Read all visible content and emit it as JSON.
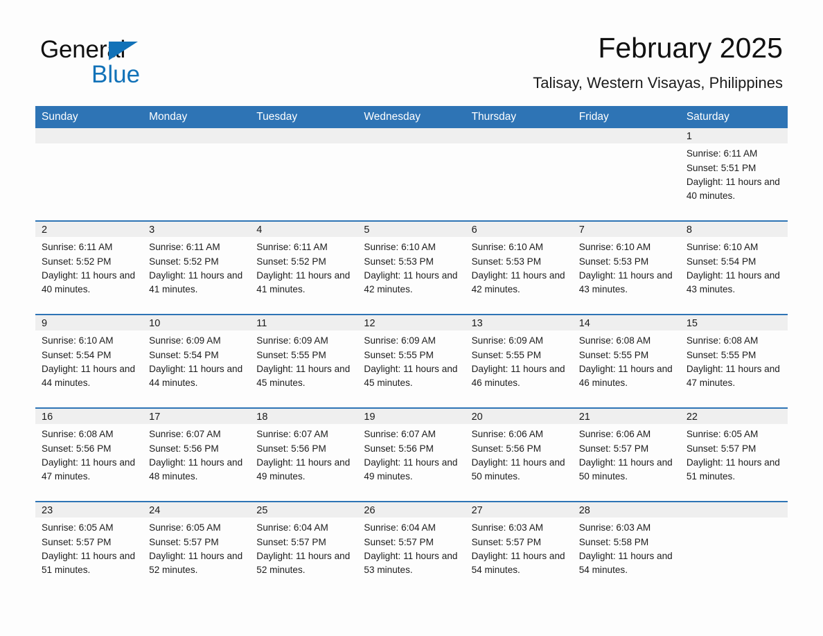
{
  "brand": {
    "name_part1": "General",
    "name_part2": "Blue",
    "accent_color": "#1272b8",
    "header_color": "#2e74b5"
  },
  "header": {
    "title": "February 2025",
    "location": "Talisay, Western Visayas, Philippines"
  },
  "calendar": {
    "weekday_headers": [
      "Sunday",
      "Monday",
      "Tuesday",
      "Wednesday",
      "Thursday",
      "Friday",
      "Saturday"
    ],
    "labels": {
      "sunrise": "Sunrise:",
      "sunset": "Sunset:",
      "daylight": "Daylight:"
    },
    "weeks": [
      [
        {
          "day": ""
        },
        {
          "day": ""
        },
        {
          "day": ""
        },
        {
          "day": ""
        },
        {
          "day": ""
        },
        {
          "day": ""
        },
        {
          "day": "1",
          "sunrise": "Sunrise: 6:11 AM",
          "sunset": "Sunset: 5:51 PM",
          "daylight": "Daylight: 11 hours and 40 minutes."
        }
      ],
      [
        {
          "day": "2",
          "sunrise": "Sunrise: 6:11 AM",
          "sunset": "Sunset: 5:52 PM",
          "daylight": "Daylight: 11 hours and 40 minutes."
        },
        {
          "day": "3",
          "sunrise": "Sunrise: 6:11 AM",
          "sunset": "Sunset: 5:52 PM",
          "daylight": "Daylight: 11 hours and 41 minutes."
        },
        {
          "day": "4",
          "sunrise": "Sunrise: 6:11 AM",
          "sunset": "Sunset: 5:52 PM",
          "daylight": "Daylight: 11 hours and 41 minutes."
        },
        {
          "day": "5",
          "sunrise": "Sunrise: 6:10 AM",
          "sunset": "Sunset: 5:53 PM",
          "daylight": "Daylight: 11 hours and 42 minutes."
        },
        {
          "day": "6",
          "sunrise": "Sunrise: 6:10 AM",
          "sunset": "Sunset: 5:53 PM",
          "daylight": "Daylight: 11 hours and 42 minutes."
        },
        {
          "day": "7",
          "sunrise": "Sunrise: 6:10 AM",
          "sunset": "Sunset: 5:53 PM",
          "daylight": "Daylight: 11 hours and 43 minutes."
        },
        {
          "day": "8",
          "sunrise": "Sunrise: 6:10 AM",
          "sunset": "Sunset: 5:54 PM",
          "daylight": "Daylight: 11 hours and 43 minutes."
        }
      ],
      [
        {
          "day": "9",
          "sunrise": "Sunrise: 6:10 AM",
          "sunset": "Sunset: 5:54 PM",
          "daylight": "Daylight: 11 hours and 44 minutes."
        },
        {
          "day": "10",
          "sunrise": "Sunrise: 6:09 AM",
          "sunset": "Sunset: 5:54 PM",
          "daylight": "Daylight: 11 hours and 44 minutes."
        },
        {
          "day": "11",
          "sunrise": "Sunrise: 6:09 AM",
          "sunset": "Sunset: 5:55 PM",
          "daylight": "Daylight: 11 hours and 45 minutes."
        },
        {
          "day": "12",
          "sunrise": "Sunrise: 6:09 AM",
          "sunset": "Sunset: 5:55 PM",
          "daylight": "Daylight: 11 hours and 45 minutes."
        },
        {
          "day": "13",
          "sunrise": "Sunrise: 6:09 AM",
          "sunset": "Sunset: 5:55 PM",
          "daylight": "Daylight: 11 hours and 46 minutes."
        },
        {
          "day": "14",
          "sunrise": "Sunrise: 6:08 AM",
          "sunset": "Sunset: 5:55 PM",
          "daylight": "Daylight: 11 hours and 46 minutes."
        },
        {
          "day": "15",
          "sunrise": "Sunrise: 6:08 AM",
          "sunset": "Sunset: 5:55 PM",
          "daylight": "Daylight: 11 hours and 47 minutes."
        }
      ],
      [
        {
          "day": "16",
          "sunrise": "Sunrise: 6:08 AM",
          "sunset": "Sunset: 5:56 PM",
          "daylight": "Daylight: 11 hours and 47 minutes."
        },
        {
          "day": "17",
          "sunrise": "Sunrise: 6:07 AM",
          "sunset": "Sunset: 5:56 PM",
          "daylight": "Daylight: 11 hours and 48 minutes."
        },
        {
          "day": "18",
          "sunrise": "Sunrise: 6:07 AM",
          "sunset": "Sunset: 5:56 PM",
          "daylight": "Daylight: 11 hours and 49 minutes."
        },
        {
          "day": "19",
          "sunrise": "Sunrise: 6:07 AM",
          "sunset": "Sunset: 5:56 PM",
          "daylight": "Daylight: 11 hours and 49 minutes."
        },
        {
          "day": "20",
          "sunrise": "Sunrise: 6:06 AM",
          "sunset": "Sunset: 5:56 PM",
          "daylight": "Daylight: 11 hours and 50 minutes."
        },
        {
          "day": "21",
          "sunrise": "Sunrise: 6:06 AM",
          "sunset": "Sunset: 5:57 PM",
          "daylight": "Daylight: 11 hours and 50 minutes."
        },
        {
          "day": "22",
          "sunrise": "Sunrise: 6:05 AM",
          "sunset": "Sunset: 5:57 PM",
          "daylight": "Daylight: 11 hours and 51 minutes."
        }
      ],
      [
        {
          "day": "23",
          "sunrise": "Sunrise: 6:05 AM",
          "sunset": "Sunset: 5:57 PM",
          "daylight": "Daylight: 11 hours and 51 minutes."
        },
        {
          "day": "24",
          "sunrise": "Sunrise: 6:05 AM",
          "sunset": "Sunset: 5:57 PM",
          "daylight": "Daylight: 11 hours and 52 minutes."
        },
        {
          "day": "25",
          "sunrise": "Sunrise: 6:04 AM",
          "sunset": "Sunset: 5:57 PM",
          "daylight": "Daylight: 11 hours and 52 minutes."
        },
        {
          "day": "26",
          "sunrise": "Sunrise: 6:04 AM",
          "sunset": "Sunset: 5:57 PM",
          "daylight": "Daylight: 11 hours and 53 minutes."
        },
        {
          "day": "27",
          "sunrise": "Sunrise: 6:03 AM",
          "sunset": "Sunset: 5:57 PM",
          "daylight": "Daylight: 11 hours and 54 minutes."
        },
        {
          "day": "28",
          "sunrise": "Sunrise: 6:03 AM",
          "sunset": "Sunset: 5:58 PM",
          "daylight": "Daylight: 11 hours and 54 minutes."
        },
        {
          "day": ""
        }
      ]
    ]
  }
}
